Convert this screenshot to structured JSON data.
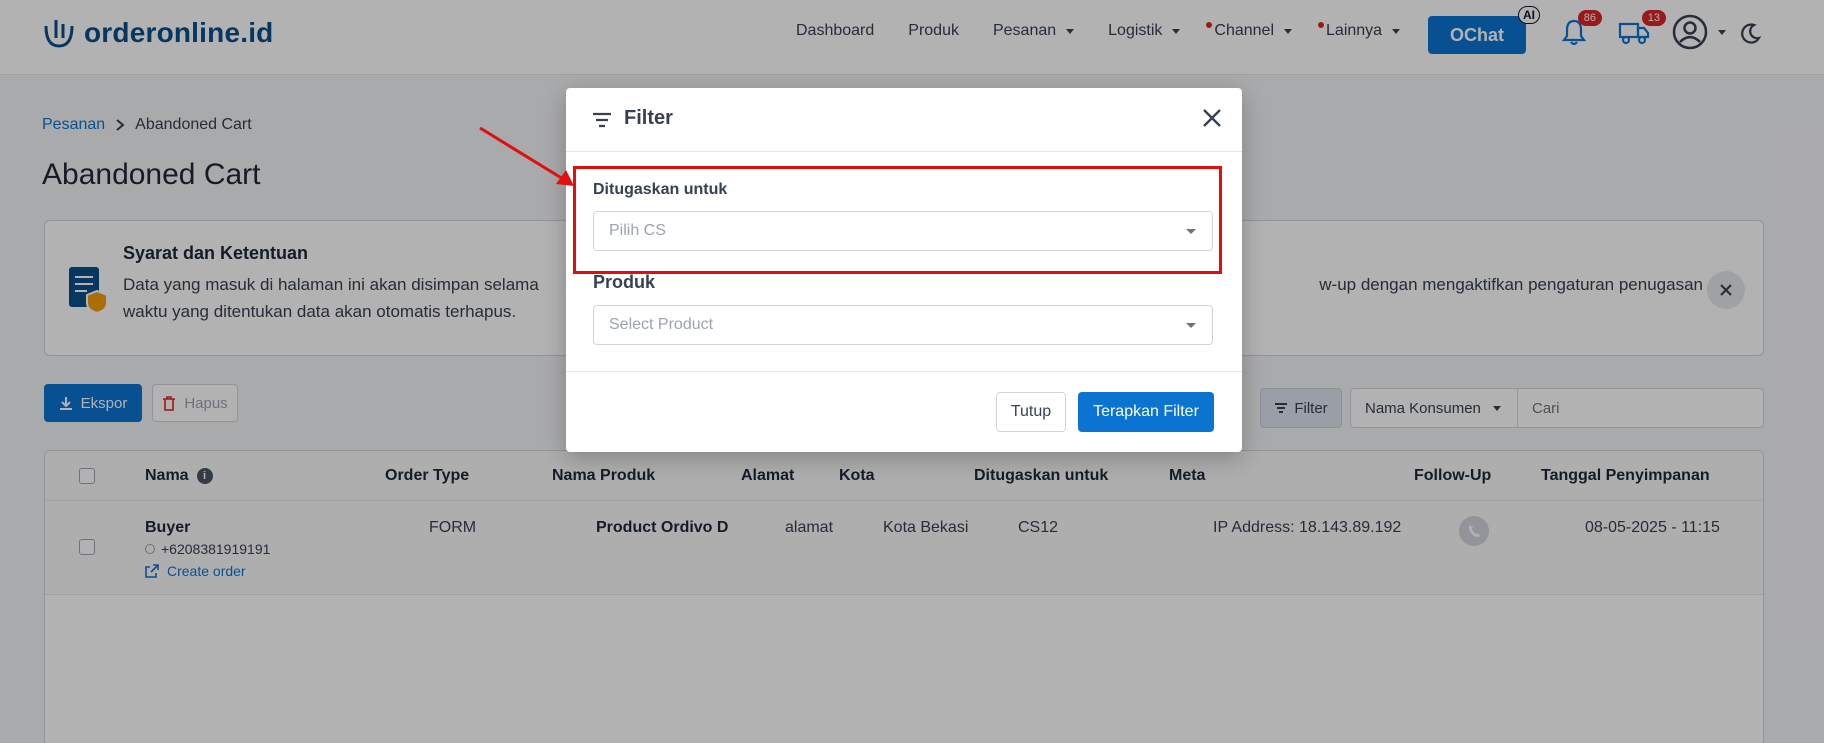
{
  "header": {
    "logo_text": "orderonline.id",
    "nav": [
      {
        "label": "Dashboard",
        "has_caret": false,
        "dot": false
      },
      {
        "label": "Produk",
        "has_caret": false,
        "dot": false
      },
      {
        "label": "Pesanan",
        "has_caret": true,
        "dot": false
      },
      {
        "label": "Logistik",
        "has_caret": true,
        "dot": false
      },
      {
        "label": "Channel",
        "has_caret": true,
        "dot": true
      },
      {
        "label": "Lainnya",
        "has_caret": true,
        "dot": true
      }
    ],
    "ochat_label": "OChat",
    "ai_badge": "AI",
    "notifications_count": "86",
    "shipping_count": "13"
  },
  "breadcrumb": {
    "parent": "Pesanan",
    "current": "Abandoned Cart"
  },
  "page_title": "Abandoned Cart",
  "notice": {
    "title": "Syarat dan Ketentuan",
    "text_line1_start": "Data yang masuk di halaman ini akan disimpan selama",
    "text_line1_end": "w-up dengan mengaktifkan pengaturan penugasan",
    "text_line2": "waktu yang ditentukan data akan otomatis terhapus."
  },
  "toolbar": {
    "ekspor_label": "Ekspor",
    "hapus_label": "Hapus",
    "filter_label": "Filter",
    "search_by": "Nama Konsumen",
    "search_placeholder": "Cari"
  },
  "table": {
    "headers": [
      "Nama",
      "Order Type",
      "Nama Produk",
      "Alamat",
      "Kota",
      "Ditugaskan untuk",
      "Meta",
      "Follow-Up",
      "Tanggal Penyimpanan"
    ],
    "rows": [
      {
        "name": "Buyer",
        "phone": "+6208381919191",
        "create_order": "Create order",
        "order_type": "FORM",
        "product": "Product Ordivo D",
        "address": "alamat",
        "city": "Kota Bekasi",
        "assigned": "CS12",
        "meta": "IP Address: 18.143.89.192",
        "date": "08-05-2025 - 11:15"
      }
    ]
  },
  "modal": {
    "title": "Filter",
    "field1_label": "Ditugaskan untuk",
    "field1_placeholder": "Pilih CS",
    "field2_label": "Produk",
    "field2_placeholder": "Select Product",
    "close_label": "Tutup",
    "apply_label": "Terapkan Filter"
  },
  "colors": {
    "primary": "#0b74d1",
    "annotation": "#e10f0f"
  }
}
